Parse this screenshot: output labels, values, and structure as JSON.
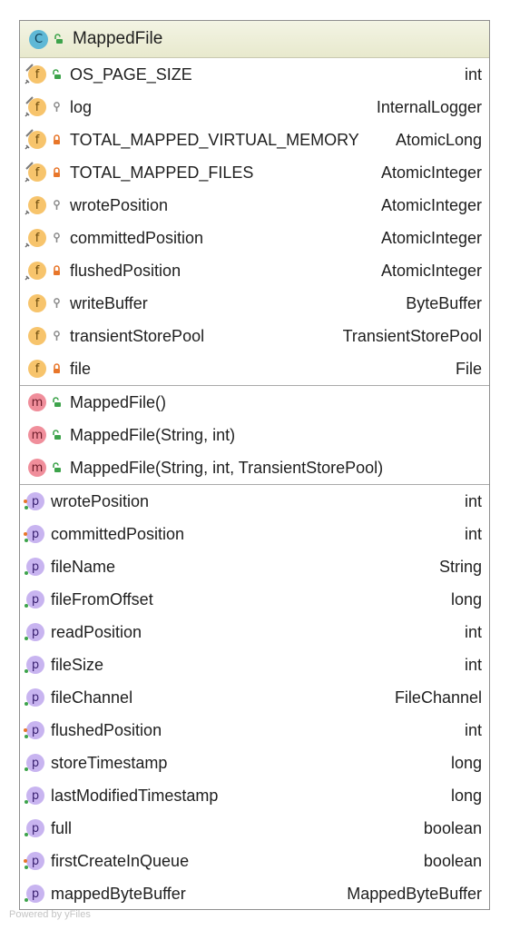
{
  "class_box": {
    "title": "MappedFile",
    "fields": [
      {
        "name": "OS_PAGE_SIZE",
        "type": "int",
        "visibility": "public",
        "static": true,
        "final": true
      },
      {
        "name": "log",
        "type": "InternalLogger",
        "visibility": "package",
        "static": true,
        "final": true
      },
      {
        "name": "TOTAL_MAPPED_VIRTUAL_MEMORY",
        "type": "AtomicLong",
        "visibility": "private",
        "static": true,
        "final": true
      },
      {
        "name": "TOTAL_MAPPED_FILES",
        "type": "AtomicInteger",
        "visibility": "private",
        "static": true,
        "final": true
      },
      {
        "name": "wrotePosition",
        "type": "AtomicInteger",
        "visibility": "package",
        "static": false,
        "final": true
      },
      {
        "name": "committedPosition",
        "type": "AtomicInteger",
        "visibility": "package",
        "static": false,
        "final": true
      },
      {
        "name": "flushedPosition",
        "type": "AtomicInteger",
        "visibility": "private",
        "static": false,
        "final": true
      },
      {
        "name": "writeBuffer",
        "type": "ByteBuffer",
        "visibility": "package",
        "static": false,
        "final": false
      },
      {
        "name": "transientStorePool",
        "type": "TransientStorePool",
        "visibility": "package",
        "static": false,
        "final": false
      },
      {
        "name": "file",
        "type": "File",
        "visibility": "private",
        "static": false,
        "final": false
      }
    ],
    "methods": [
      {
        "name": "MappedFile()",
        "visibility": "public"
      },
      {
        "name": "MappedFile(String, int)",
        "visibility": "public"
      },
      {
        "name": "MappedFile(String, int, TransientStorePool)",
        "visibility": "public"
      }
    ],
    "properties": [
      {
        "name": "wrotePosition",
        "type": "int",
        "marks": [
          "orange",
          "green"
        ]
      },
      {
        "name": "committedPosition",
        "type": "int",
        "marks": [
          "orange",
          "green"
        ]
      },
      {
        "name": "fileName",
        "type": "String",
        "marks": [
          "green"
        ]
      },
      {
        "name": "fileFromOffset",
        "type": "long",
        "marks": [
          "green"
        ]
      },
      {
        "name": "readPosition",
        "type": "int",
        "marks": [
          "green"
        ]
      },
      {
        "name": "fileSize",
        "type": "int",
        "marks": [
          "green"
        ]
      },
      {
        "name": "fileChannel",
        "type": "FileChannel",
        "marks": [
          "green"
        ]
      },
      {
        "name": "flushedPosition",
        "type": "int",
        "marks": [
          "orange",
          "green"
        ]
      },
      {
        "name": "storeTimestamp",
        "type": "long",
        "marks": [
          "green"
        ]
      },
      {
        "name": "lastModifiedTimestamp",
        "type": "long",
        "marks": [
          "green"
        ]
      },
      {
        "name": "full",
        "type": "boolean",
        "marks": [
          "green"
        ]
      },
      {
        "name": "firstCreateInQueue",
        "type": "boolean",
        "marks": [
          "orange",
          "green"
        ]
      },
      {
        "name": "mappedByteBuffer",
        "type": "MappedByteBuffer",
        "marks": [
          "green"
        ]
      }
    ]
  },
  "icons": {
    "class": "C",
    "field": "f",
    "method": "m",
    "property": "p"
  },
  "colors": {
    "header_bg": "#e8e9cd",
    "field_badge": "#f7c46c",
    "method_badge": "#f08e9b",
    "property_badge": "#c8b4f0",
    "class_badge": "#5fb8d6",
    "public_lock": "#3da34b",
    "private_lock": "#e8762a",
    "package_pin": "#8a8a8a"
  },
  "footer": "Powered by yFiles"
}
